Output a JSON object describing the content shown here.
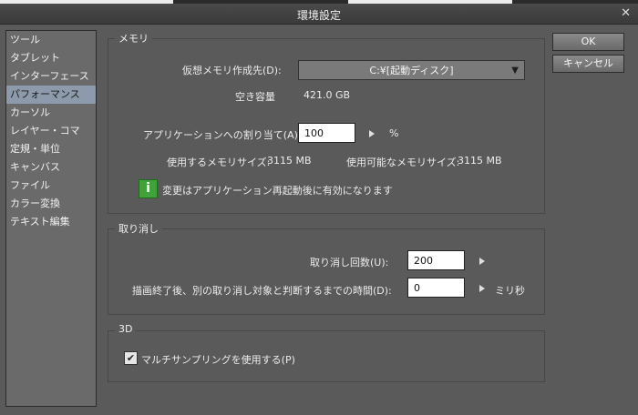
{
  "window": {
    "title": "環境設定",
    "close_glyph": "✕"
  },
  "sidebar": {
    "items": [
      {
        "label": "ツール"
      },
      {
        "label": "タブレット"
      },
      {
        "label": "インターフェース"
      },
      {
        "label": "パフォーマンス"
      },
      {
        "label": "カーソル"
      },
      {
        "label": "レイヤー・コマ"
      },
      {
        "label": "定規・単位"
      },
      {
        "label": "キャンバス"
      },
      {
        "label": "ファイル"
      },
      {
        "label": "カラー変換"
      },
      {
        "label": "テキスト編集"
      }
    ],
    "selected_index": 3
  },
  "memory": {
    "title": "メモリ",
    "virtual_label": "仮想メモリ作成先(D):",
    "virtual_value": "C:¥[起動ディスク]",
    "free_label": "空き容量",
    "free_value": "421.0 GB",
    "alloc_label": "アプリケーションへの割り当て(A):",
    "alloc_value": "100",
    "alloc_unit": "%",
    "used_label": "使用するメモリサイズ:",
    "used_value": "3115 MB",
    "avail_label": "使用可能なメモリサイズ:",
    "avail_value": "3115 MB",
    "info_glyph": "i",
    "info_text": "変更はアプリケーション再起動後に有効になります"
  },
  "undo": {
    "title": "取り消し",
    "count_label": "取り消し回数(U):",
    "count_value": "200",
    "time_label": "描画終了後、別の取り消し対象と判断するまでの時間(D):",
    "time_value": "0",
    "time_unit": "ミリ秒"
  },
  "threed": {
    "title": "3D",
    "multisample_label": "マルチサンプリングを使用する(P)",
    "multisample_checked": true
  },
  "buttons": {
    "ok": "OK",
    "cancel": "キャンセル"
  },
  "icons": {
    "dropdown": "▼",
    "check": "✔"
  }
}
